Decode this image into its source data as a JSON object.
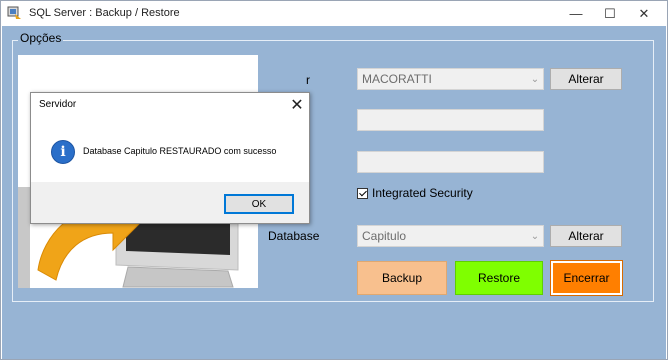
{
  "window": {
    "title": "SQL Server : Backup / Restore",
    "minimize_glyph": "—",
    "maximize_glyph": "☐",
    "close_glyph": "✕",
    "client_color": "#97b4d4"
  },
  "options": {
    "legend": "Opções",
    "server_label_tail": "r",
    "server_value": "MACORATTI",
    "server_change_label": "Alterar",
    "integrated_security_label": "Integrated Security",
    "integrated_security_checked": true,
    "database_label": "Database",
    "database_value": "Capitulo",
    "database_change_label": "Alterar"
  },
  "actions": {
    "backup_label": "Backup",
    "restore_label": "Restore",
    "exit_label": "Encerrar",
    "backup_color": "#f8c08e",
    "restore_color": "#7fff00",
    "exit_color": "#ff7f00"
  },
  "dialog": {
    "title": "Servidor",
    "message": "Database Capitulo RESTAURADO com sucesso",
    "icon": "info-icon",
    "icon_glyph": "i",
    "ok_label": "OK",
    "close_glyph": "✕"
  }
}
